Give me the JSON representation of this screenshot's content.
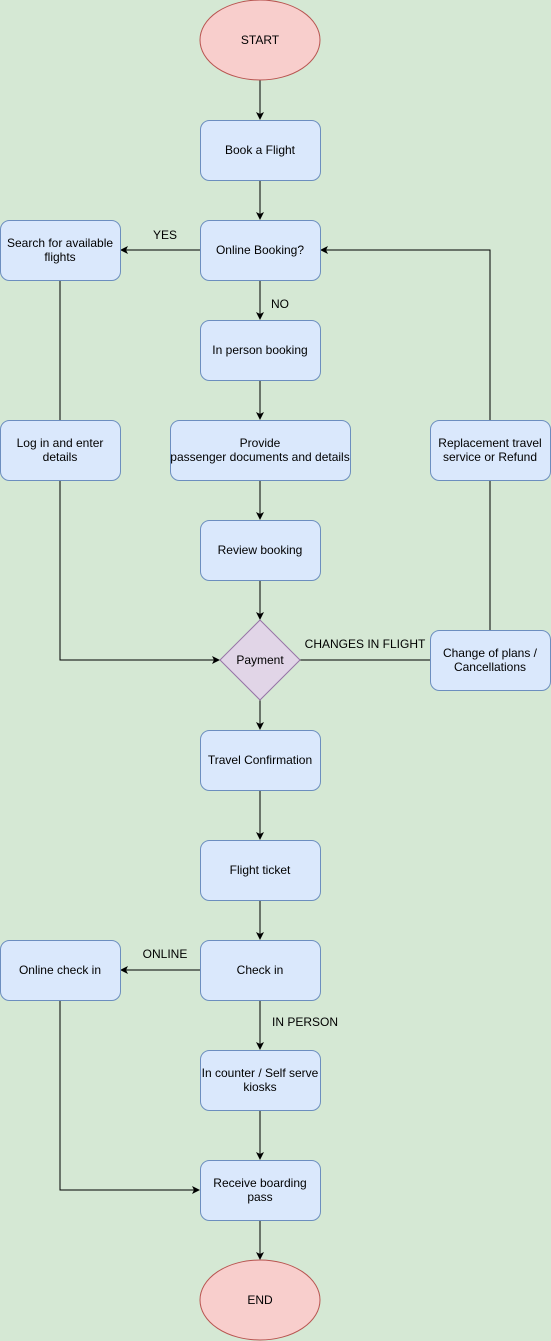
{
  "nodes": {
    "start": "START",
    "book": "Book a Flight",
    "online_booking": "Online Booking?",
    "search": [
      "Search for available",
      "flights"
    ],
    "in_person": "In person booking",
    "login": [
      "Log in and enter",
      "details"
    ],
    "provide": [
      "Provide",
      "passenger documents and details"
    ],
    "replacement": [
      "Replacement travel",
      "service or Refund"
    ],
    "review": "Review booking",
    "payment": "Payment",
    "change": [
      "Change of plans /",
      "Cancellations"
    ],
    "travel_confirmation": "Travel Confirmation",
    "ticket": "Flight ticket",
    "check_in": "Check in",
    "online_check_in": "Online check in",
    "counter": [
      "In counter / Self serve",
      "kiosks"
    ],
    "boarding": [
      "Receive boarding",
      "pass"
    ],
    "end": "END"
  },
  "edge_labels": {
    "yes": "YES",
    "no": "NO",
    "changes": "CHANGES IN FLIGHT",
    "online": "ONLINE",
    "in_person": "IN PERSON"
  },
  "colors": {
    "background": "#d5e8d4",
    "process_fill": "#dae8fc",
    "process_stroke": "#6c8ebf",
    "decision_fill": "#e1d5e7",
    "decision_stroke": "#9673a6",
    "terminal_fill": "#f8cecc",
    "terminal_stroke": "#b85450"
  }
}
